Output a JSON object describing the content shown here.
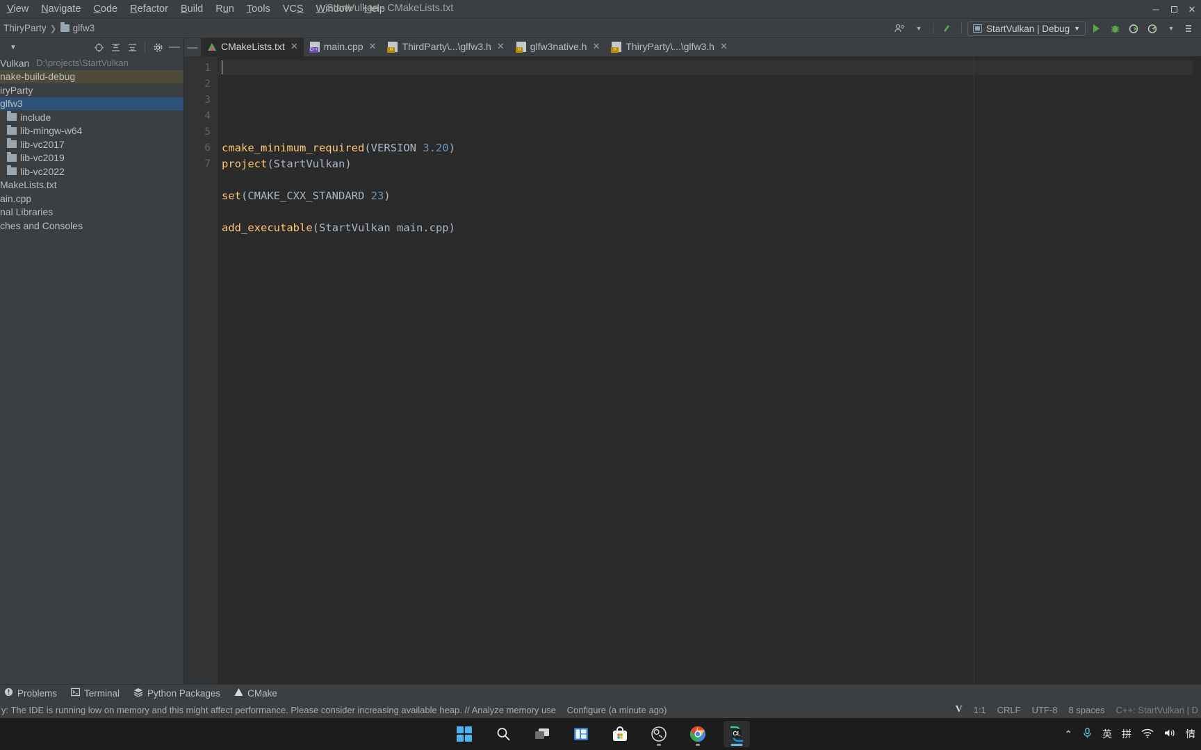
{
  "menubar": {
    "items": [
      {
        "label": "View",
        "mnemonic": "V"
      },
      {
        "label": "Navigate",
        "mnemonic": "N"
      },
      {
        "label": "Code",
        "mnemonic": "C"
      },
      {
        "label": "Refactor",
        "mnemonic": "R"
      },
      {
        "label": "Build",
        "mnemonic": "B"
      },
      {
        "label": "Run",
        "mnemonic": "u"
      },
      {
        "label": "Tools",
        "mnemonic": "T"
      },
      {
        "label": "VCS",
        "mnemonic": "S"
      },
      {
        "label": "Window",
        "mnemonic": "W"
      },
      {
        "label": "Help",
        "mnemonic": "H"
      }
    ],
    "window_title": "StartVulkan - CMakeLists.txt",
    "controls": {
      "minimize": "─",
      "maximize": "☐",
      "close": "✕"
    }
  },
  "navrow": {
    "breadcrumb": [
      "ThiryParty",
      "glfw3"
    ],
    "run_config": "StartVulkan | Debug",
    "icons": [
      "account-icon",
      "chevron-down-icon",
      "update-arrow-icon",
      "run-icon",
      "debug-icon",
      "coverage-icon",
      "profile-icon",
      "chevron-down-icon",
      "more-icon"
    ]
  },
  "sidebar": {
    "tools": [
      "target-icon",
      "expand-all-icon",
      "collapse-all-icon",
      "gear-icon",
      "hide-icon"
    ],
    "tree": [
      {
        "label": "Vulkan",
        "path": "D:\\projects\\StartVulkan",
        "indent": 0,
        "icon": "none",
        "state": "normal"
      },
      {
        "label": "nake-build-debug",
        "indent": 0,
        "icon": "none",
        "state": "mark"
      },
      {
        "label": "iryParty",
        "indent": 0,
        "icon": "none",
        "state": "normal"
      },
      {
        "label": "glfw3",
        "indent": 0,
        "icon": "none",
        "state": "selected"
      },
      {
        "label": "include",
        "indent": 1,
        "icon": "folder",
        "state": "normal"
      },
      {
        "label": "lib-mingw-w64",
        "indent": 1,
        "icon": "folder",
        "state": "normal"
      },
      {
        "label": "lib-vc2017",
        "indent": 1,
        "icon": "folder",
        "state": "normal"
      },
      {
        "label": "lib-vc2019",
        "indent": 1,
        "icon": "folder",
        "state": "normal"
      },
      {
        "label": "lib-vc2022",
        "indent": 1,
        "icon": "folder",
        "state": "normal"
      },
      {
        "label": "MakeLists.txt",
        "indent": 0,
        "icon": "none",
        "state": "normal"
      },
      {
        "label": "ain.cpp",
        "indent": 0,
        "icon": "none",
        "state": "normal"
      },
      {
        "label": "nal Libraries",
        "indent": 0,
        "icon": "none",
        "state": "normal"
      },
      {
        "label": "ches and Consoles",
        "indent": 0,
        "icon": "none",
        "state": "normal"
      }
    ]
  },
  "tabs": [
    {
      "label": "CMakeLists.txt",
      "icon": "cmake",
      "active": true
    },
    {
      "label": "main.cpp",
      "icon": "cpp",
      "active": false
    },
    {
      "label": "ThirdParty\\...\\glfw3.h",
      "icon": "hdr",
      "active": false
    },
    {
      "label": "glfw3native.h",
      "icon": "hdr",
      "active": false
    },
    {
      "label": "ThiryParty\\...\\glfw3.h",
      "icon": "hdr",
      "active": false
    }
  ],
  "editor": {
    "line_numbers": [
      "1",
      "2",
      "3",
      "4",
      "5",
      "6",
      "7"
    ],
    "lines": [
      {
        "n": 1,
        "text": "cmake_minimum_required(VERSION 3.20)"
      },
      {
        "n": 2,
        "text": "project(StartVulkan)"
      },
      {
        "n": 3,
        "text": ""
      },
      {
        "n": 4,
        "text": "set(CMAKE_CXX_STANDARD 23)"
      },
      {
        "n": 5,
        "text": ""
      },
      {
        "n": 6,
        "text": "add_executable(StartVulkan main.cpp)"
      },
      {
        "n": 7,
        "text": ""
      }
    ]
  },
  "bottom_tools": [
    {
      "label": "Problems",
      "icon": "problems-icon"
    },
    {
      "label": "Terminal",
      "icon": "terminal-icon"
    },
    {
      "label": "Python Packages",
      "icon": "packages-icon"
    },
    {
      "label": "CMake",
      "icon": "cmake-icon"
    }
  ],
  "statusbar": {
    "message": "y: The IDE is running low on memory and this might affect performance. Please consider increasing available heap. // Analyze memory use",
    "action": "Configure (a minute ago)",
    "vcs": "V",
    "caret": "1:1",
    "line_sep": "CRLF",
    "encoding": "UTF-8",
    "indent": "8 spaces",
    "toolchain": "C++: StartVulkan | D"
  },
  "taskbar": {
    "items": [
      {
        "name": "start-button",
        "icon": "windows-logo"
      },
      {
        "name": "search-button",
        "icon": "search-icon"
      },
      {
        "name": "task-view-button",
        "icon": "task-view-icon"
      },
      {
        "name": "widgets-button",
        "icon": "widgets-icon"
      },
      {
        "name": "store-button",
        "icon": "store-icon"
      },
      {
        "name": "obs-button",
        "icon": "obs-icon"
      },
      {
        "name": "chrome-button",
        "icon": "chrome-icon"
      },
      {
        "name": "clion-button",
        "icon": "clion-icon"
      }
    ],
    "tray": [
      "∧",
      "mic-icon",
      "英",
      "拼",
      "wifi-icon",
      "volume-icon",
      "ime-icon"
    ]
  },
  "colors": {
    "bg_panel": "#3c3f41",
    "bg_editor": "#2b2b2b",
    "accent_select": "#2d5177",
    "mark": "#4e4b38",
    "keyword": "#ffc66d",
    "text": "#a9b7c6",
    "number": "#6897bb",
    "run_green": "#57a64a"
  }
}
